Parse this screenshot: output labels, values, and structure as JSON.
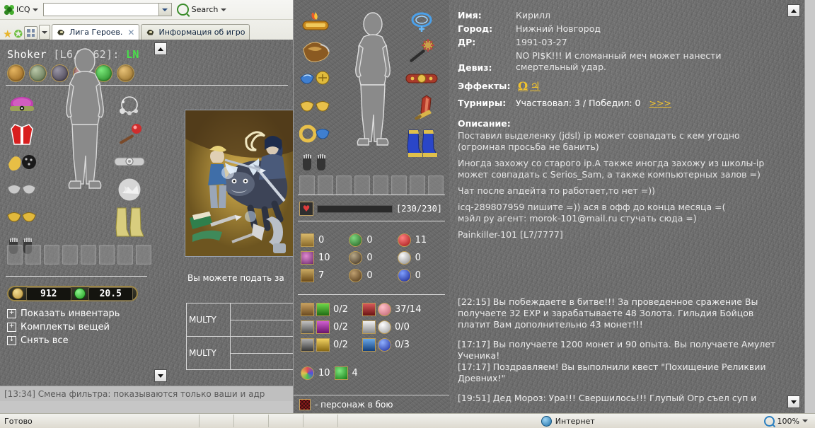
{
  "browser": {
    "icq_label": "ICQ",
    "address_value": "",
    "address_placeholder": "",
    "search_label": "Search",
    "tabs": [
      {
        "label": "Лига Героев.",
        "active": true,
        "closable": true
      },
      {
        "label": "Информация об игро",
        "active": false,
        "closable": false
      }
    ]
  },
  "left_panel": {
    "char_title": "Shoker",
    "char_level": "[L6/5162]:",
    "char_align": "LN",
    "action_buttons": [
      {
        "name": "potion-button",
        "color": "#b07a2a"
      },
      {
        "name": "levelup-button",
        "color": "#5a7a4a"
      },
      {
        "name": "home-button",
        "color": "#4a4350"
      },
      {
        "name": "tools-button",
        "color": "#7a4a4a"
      },
      {
        "name": "status-button",
        "color": "#2f7a2f"
      },
      {
        "name": "scroll-button",
        "color": "#a07a30"
      }
    ],
    "money": {
      "gold": "912",
      "gems": "20.5"
    },
    "links": [
      {
        "label": "Показать инвентарь",
        "icon": "+"
      },
      {
        "label": "Комплекты вещей",
        "icon": "+"
      },
      {
        "label": "Снять все",
        "icon": "↓"
      }
    ],
    "bid_text": "Вы можете подать за",
    "bid_rows": [
      {
        "name": "MULTY"
      },
      {
        "name": "MULTY"
      }
    ],
    "chat_line": "[13:34] Смена фильтра: показываются только ваши и адр"
  },
  "center_panel": {
    "hp": {
      "current": 230,
      "max": 230,
      "text": "[230/230]",
      "percent": 100,
      "color": "#3fd020"
    },
    "stats": [
      {
        "icon": "book-icon",
        "value": "0"
      },
      {
        "icon": "mind-icon",
        "value": "0"
      },
      {
        "icon": "ruby-icon",
        "value": "11"
      },
      {
        "icon": "brain-icon",
        "value": "10"
      },
      {
        "icon": "shadow-icon",
        "value": "0"
      },
      {
        "icon": "silver-icon",
        "value": "0"
      },
      {
        "icon": "horseshoe-icon",
        "value": "7"
      },
      {
        "icon": "earth-icon",
        "value": "0"
      },
      {
        "icon": "sapphire-icon",
        "value": "0"
      }
    ],
    "equip_rows": [
      {
        "left_icons": [
          "club-icon",
          "green-armor-icon"
        ],
        "left_value": "0/2",
        "right_icons": [
          "red-wand-icon",
          "pink-orb-icon"
        ],
        "right_value": "37/14"
      },
      {
        "left_icons": [
          "sword-icon",
          "purple-armor-icon"
        ],
        "left_value": "0/2",
        "right_icons": [
          "white-wand-icon",
          "white-orb-icon"
        ],
        "right_value": "0/0"
      },
      {
        "left_icons": [
          "dagger-icon",
          "gold-armor-icon"
        ],
        "left_value": "0/2",
        "right_icons": [
          "blue-wand-icon",
          "blue-orb-icon"
        ],
        "right_value": "0/3"
      }
    ],
    "last_row": [
      {
        "icon": "prism-icon",
        "value": "10"
      },
      {
        "icon": "emerald-icon",
        "value": "4"
      }
    ],
    "footer_legend": "- персонаж в бою"
  },
  "right_panel": {
    "fields": [
      {
        "label": "Имя:",
        "value": "Кирилл"
      },
      {
        "label": "Город:",
        "value": "Нижний Новгород"
      },
      {
        "label": "ДР:",
        "value": "1991-03-27"
      },
      {
        "label": "Девиз:",
        "value": "NO PI$K!!! И сломанный меч может нанести\nсмертельный удар."
      }
    ],
    "effects_label": "Эффекты:",
    "effects": [
      "Ω",
      "♃"
    ],
    "tournaments_label": "Турниры:",
    "tournaments_value": "Участвовал: 3 / Победил: 0",
    "tournaments_more": ">>>",
    "description_label": "Описание:",
    "description_paragraphs": [
      "Поставил выделенку (jdsl) ip может совпадать с кем угодно\n(огромная просьба не банить)",
      "Иногда захожу со старого ip.А также иногда захожу из школы-ip\nможет совпадать с Serios_Sam, а также компьютерных залов =)",
      "Чат после апдейта то работает,то нет =))",
      "icq-289807959 пишите =)) ася в офф до конца месяца =(\nмэйл ру агент: morok-101@mail.ru стучать сюда =)",
      "Painkiller-101 [L7/7777]"
    ],
    "log_entries": [
      "[22:15] Вы побеждаете в битве!!! За проведенное сражение Вы\nполучаете 32 EXP и зарабатываете 48 Золота. Гильдия Бойцов\nплатит Вам дополнительно 43 монет!!!",
      "[17:17] Вы получаете 1200 монет и 90 опыта. Вы получаете Амулет\nУченика!\n[17:17] Поздравляем! Вы выполнили квест \"Похищение Реликвии\nДревних!\"",
      "[19:51] Дед Мороз: Ура!!! Свершилось!!! Глупый Огр съел суп и"
    ]
  },
  "statusbar": {
    "ready": "Готово",
    "zone": "Интернет",
    "zoom": "100%"
  },
  "colors": {
    "accent_gold": "#f2c42e",
    "hp_green": "#3fd020",
    "align_green": "#49e04b",
    "stone_bg": "#6e6e6e"
  }
}
